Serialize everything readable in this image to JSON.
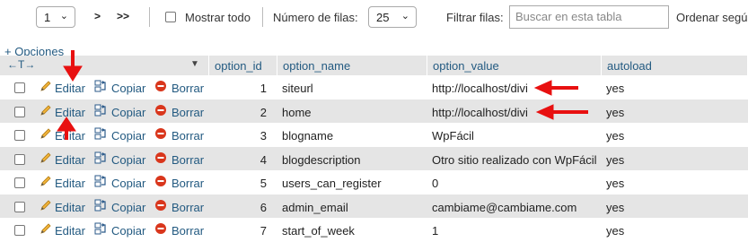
{
  "toolbar": {
    "page_value": "1",
    "next_label": ">",
    "last_label": ">>",
    "show_all_label": "Mostrar todo",
    "rows_label": "Número de filas:",
    "rows_value": "25",
    "filter_label": "Filtrar filas:",
    "search_placeholder": "Buscar en esta tabla",
    "sort_label": "Ordenar segú"
  },
  "options_link": "+ Opciones",
  "resize_glyph": "←T→",
  "columns": [
    "option_id",
    "option_name",
    "option_value",
    "autoload"
  ],
  "actions": {
    "edit": "Editar",
    "copy": "Copiar",
    "delete": "Borrar"
  },
  "rows": [
    {
      "id": "1",
      "name": "siteurl",
      "value": "http://localhost/divi",
      "autoload": "yes"
    },
    {
      "id": "2",
      "name": "home",
      "value": "http://localhost/divi",
      "autoload": "yes"
    },
    {
      "id": "3",
      "name": "blogname",
      "value": "WpFácil",
      "autoload": "yes"
    },
    {
      "id": "4",
      "name": "blogdescription",
      "value": "Otro sitio realizado con WpFácil",
      "autoload": "yes"
    },
    {
      "id": "5",
      "name": "users_can_register",
      "value": "0",
      "autoload": "yes"
    },
    {
      "id": "6",
      "name": "admin_email",
      "value": "cambiame@cambiame.com",
      "autoload": "yes"
    },
    {
      "id": "7",
      "name": "start_of_week",
      "value": "1",
      "autoload": "yes"
    }
  ],
  "colors": {
    "header_bg": "#e5e5e5",
    "link": "#235a81",
    "annotation": "#e81010",
    "delete": "#d9361c"
  }
}
